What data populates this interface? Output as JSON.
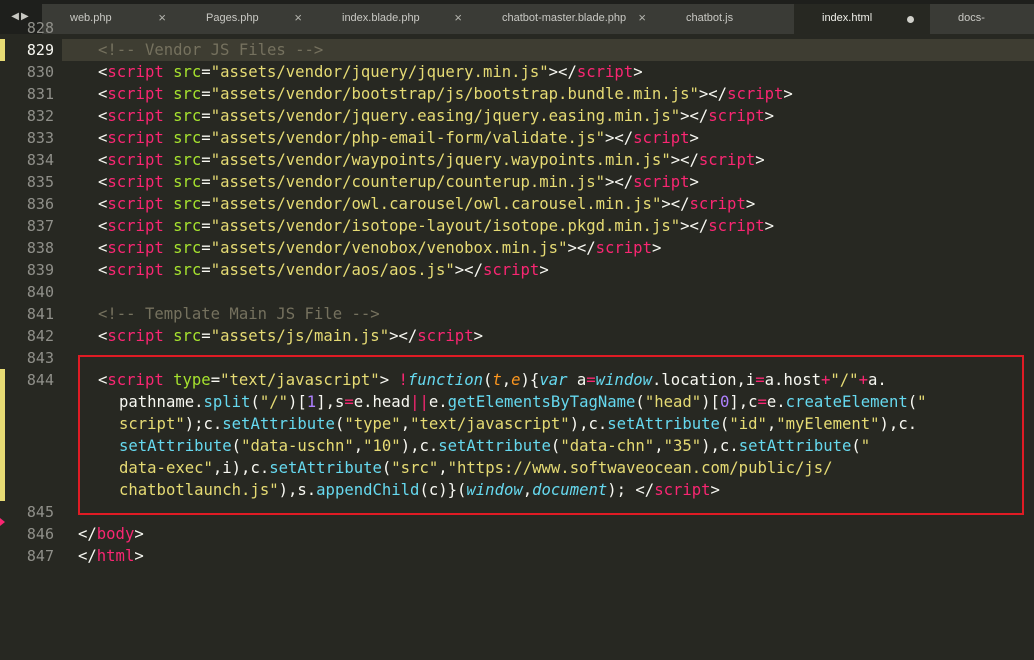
{
  "tabs": [
    {
      "label": "web.php",
      "state": "close"
    },
    {
      "label": "Pages.php",
      "state": "close"
    },
    {
      "label": "index.blade.php",
      "state": "close"
    },
    {
      "label": "chatbot-master.blade.php",
      "state": "close"
    },
    {
      "label": "chatbot.js",
      "state": "none"
    },
    {
      "label": "index.html",
      "state": "modified",
      "active": true
    },
    {
      "label": "docs-page.blade.php",
      "state": "none"
    }
  ],
  "tab_close_glyph": "×",
  "nav": {
    "back": "◀",
    "forward": "▶"
  },
  "line_numbers": {
    "partial": "828",
    "l829": "829",
    "l830": "830",
    "l831": "831",
    "l832": "832",
    "l833": "833",
    "l834": "834",
    "l835": "835",
    "l836": "836",
    "l837": "837",
    "l838": "838",
    "l839": "839",
    "l840": "840",
    "l841": "841",
    "l842": "842",
    "l843": "843",
    "l844": "844",
    "l845": "845",
    "l846": "846",
    "l847": "847"
  },
  "code": {
    "vendor_comment": "<!-- Vendor JS Files -->",
    "scripts": [
      "assets/vendor/jquery/jquery.min.js",
      "assets/vendor/bootstrap/js/bootstrap.bundle.min.js",
      "assets/vendor/jquery.easing/jquery.easing.min.js",
      "assets/vendor/php-email-form/validate.js",
      "assets/vendor/waypoints/jquery.waypoints.min.js",
      "assets/vendor/counterup/counterup.min.js",
      "assets/vendor/owl.carousel/owl.carousel.min.js",
      "assets/vendor/isotope-layout/isotope.pkgd.min.js",
      "assets/vendor/venobox/venobox.min.js",
      "assets/vendor/aos/aos.js"
    ],
    "template_comment": "<!-- Template Main JS File -->",
    "main_script": "assets/js/main.js",
    "tag_open": "<",
    "tag_close_end": "></",
    "tag_end": ">",
    "script_kw": "script",
    "src_kw": "src",
    "type_kw": "type",
    "eq": "=",
    "q": "\"",
    "body_kw": "body",
    "html_kw": "html",
    "close_open": "</",
    "inline": {
      "type_val": "\"text/javascript\"",
      "bang": "!",
      "function_kw": "function",
      "paren_open": "(",
      "param_t": "t",
      "comma": ",",
      "param_e": "e",
      "brace_open": "){",
      "var_kw": "var",
      "sp_a": " a",
      "window": "window",
      "dot_location": ".location,i",
      "a_host": "a.host",
      "plus": "+",
      "slash_str": "\"/\"",
      "a_end": "a.",
      "pathname": "pathname.",
      "split": "split",
      "bracket_1": ")[",
      "one": "1",
      "s_part": "],s",
      "e_head": "e.head",
      "oror": "||",
      "e_dot": "e.",
      "getElements": "getElementsByTagName",
      "head_str": "\"head\"",
      "zero": "0",
      "c_part": "],c",
      "createElement": "createElement",
      "open_q": "(\"",
      "script_str_end": "script\"",
      "semi_c": ");c.",
      "setAttribute": "setAttribute",
      "type_str": "\"type\"",
      "text_js_str": "\"text/javascript\"",
      "close_c": "),c.",
      "id_str": "\"id\"",
      "myElement_str": "\"myElement\"",
      "c_end": "),c.",
      "data_uschn_str": "\"data-uschn\"",
      "ten_str": "\"10\"",
      "data_chn_str": "\"data-chn\"",
      "thirtyfive_str": "\"35\"",
      "quote_open": "\"",
      "data_exec_str": "data-exec\"",
      "i_var": "i",
      "src_str": "\"src\"",
      "url_str_a": "\"https://www.softwaveocean.com/public/js/",
      "url_str_b": "chatbotlaunch.js\"",
      "s_dot": "),s.",
      "appendChild": "appendChild",
      "c_call": "(c)}(",
      "window2": "window",
      "document": "document",
      "end_call": "); </"
    }
  },
  "colors": {
    "background": "#272822",
    "tag": "#f92672",
    "attribute": "#a6e22e",
    "string": "#e6db74",
    "comment": "#75715e",
    "number": "#ae81ff",
    "keyword": "#66d9ef",
    "parameter": "#fd971f",
    "highlight_border": "#e01b24"
  }
}
